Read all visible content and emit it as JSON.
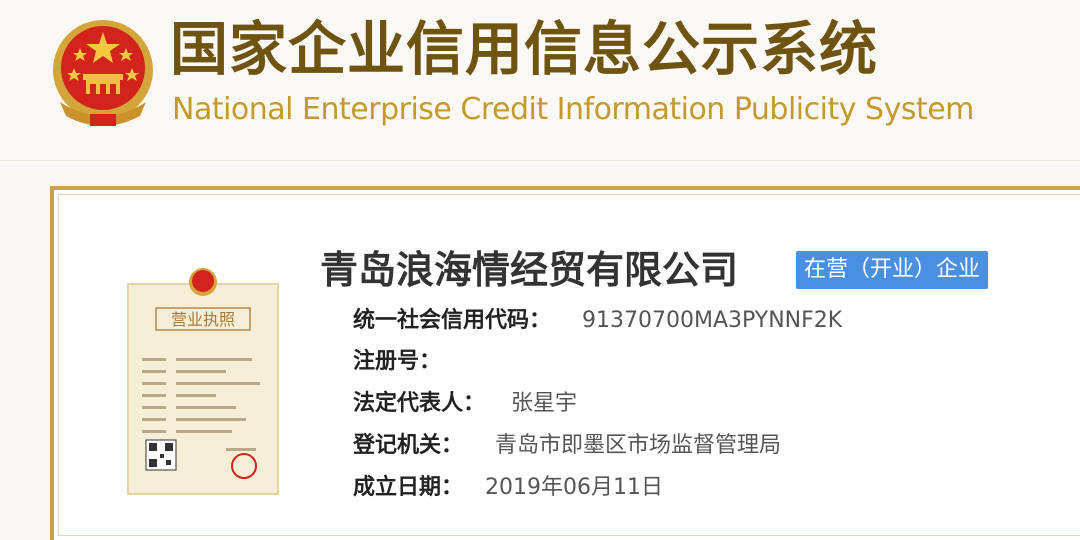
{
  "header": {
    "title_cn": "国家企业信用信息公示系统",
    "title_en": "National Enterprise Credit Information Publicity System",
    "emblem_icon": "national-emblem-icon"
  },
  "company": {
    "name": "青岛浪海情经贸有限公司",
    "status": "在营（开业）企业",
    "license_icon": "business-license-icon",
    "fields": [
      {
        "label": "统一社会信用代码：",
        "value": "91370700MA3PYNNF2K"
      },
      {
        "label": "注册号：",
        "value": ""
      },
      {
        "label": "法定代表人：",
        "value": "张星宇"
      },
      {
        "label": "登记机关：",
        "value": "青岛市即墨区市场监督管理局"
      },
      {
        "label": "成立日期：",
        "value": "2019年06月11日"
      }
    ]
  },
  "license_image": {
    "title": "营业执照"
  },
  "colors": {
    "brand_brown": "#6e5410",
    "brand_gold": "#c59a2c",
    "panel_border": "#c9a24a",
    "badge_blue": "#4a90e2"
  }
}
